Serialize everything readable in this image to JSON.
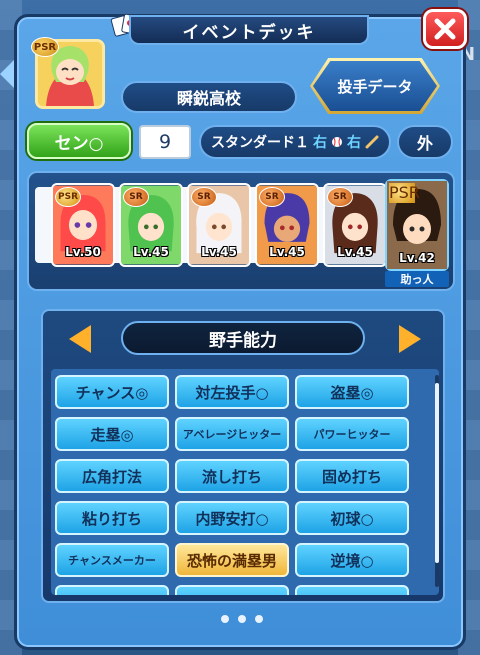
{
  "header": {
    "title": "イベントデッキ"
  },
  "player": {
    "rank": "PSR",
    "school": "瞬鋭高校"
  },
  "buttons": {
    "pitcher_data": "投手データ",
    "position": "セン○",
    "outfield": "外"
  },
  "batting": {
    "number": "9",
    "order": "スタンダード１",
    "throw": "右",
    "bat": "右"
  },
  "deck": {
    "cards": [
      {
        "rank": "PSR",
        "level": "Lv.50"
      },
      {
        "rank": "SR",
        "level": "Lv.45"
      },
      {
        "rank": "SR",
        "level": "Lv.45"
      },
      {
        "rank": "SR",
        "level": "Lv.45"
      },
      {
        "rank": "SR",
        "level": "Lv.45"
      }
    ],
    "helper": {
      "rank": "PSR",
      "level": "Lv.42",
      "label": "助っ人"
    }
  },
  "abilities": {
    "category": "野手能力",
    "items": [
      "チャンス◎",
      "対左投手○",
      "盗塁◎",
      "走塁◎",
      "アベレージヒッター",
      "パワーヒッター",
      "広角打法",
      "流し打ち",
      "固め打ち",
      "粘り打ち",
      "内野安打○",
      "初球○",
      "チャンスメーカー",
      "恐怖の満塁男",
      "逆境○"
    ]
  },
  "pager": {
    "current": 1,
    "count": 3
  }
}
